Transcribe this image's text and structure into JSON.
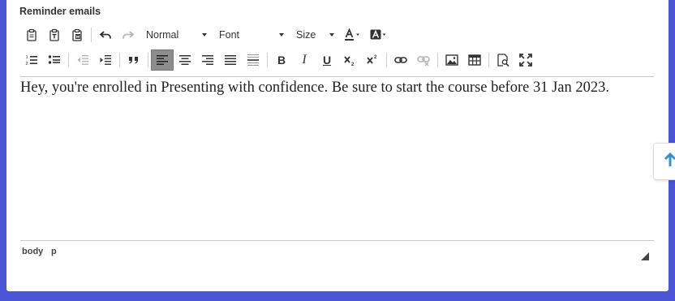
{
  "section": {
    "title": "Reminder emails"
  },
  "toolbar": {
    "format_select": "Normal",
    "font_select": "Font",
    "size_select": "Size",
    "bold_label": "B",
    "italic_label": "I",
    "underline_label": "U"
  },
  "editor": {
    "content": "Hey, you're enrolled in Presenting with confidence. Be sure to start the course before 31 Jan 2023."
  },
  "statusbar": {
    "path": [
      "body",
      "p"
    ]
  },
  "colors": {
    "background": "#4a55d6",
    "active_button": "#8c8c8c",
    "scroll_arrow": "#3a8fd0"
  }
}
